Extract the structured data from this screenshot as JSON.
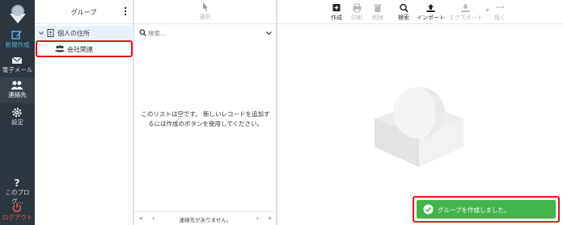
{
  "nav": {
    "compose": "新規作成",
    "mail": "電子メール",
    "contacts": "連絡先",
    "settings": "設定",
    "about": "このプログ...",
    "logout": "ログアウト"
  },
  "groups": {
    "title": "グループ",
    "items": [
      {
        "label": "個人の住所"
      },
      {
        "label": "会社関連"
      }
    ]
  },
  "list": {
    "select_label": "選択",
    "search_placeholder": "検索...",
    "empty_message": "このリストは空です。 新しいレコードを追加するには作成のボタンを使用してください。",
    "footer_text": "連絡先がありません。"
  },
  "toolbar": {
    "create": "作成",
    "print": "印刷",
    "delete": "削除",
    "search": "検索",
    "import": "インポート",
    "export": "エクスポート",
    "more": "続く"
  },
  "toast": {
    "message": "グループを作成しました。"
  },
  "colors": {
    "nav_bg": "#2c363f",
    "accent_blue": "#5aaee0",
    "toast_green": "#41b549",
    "highlight_red": "#e0181f"
  }
}
